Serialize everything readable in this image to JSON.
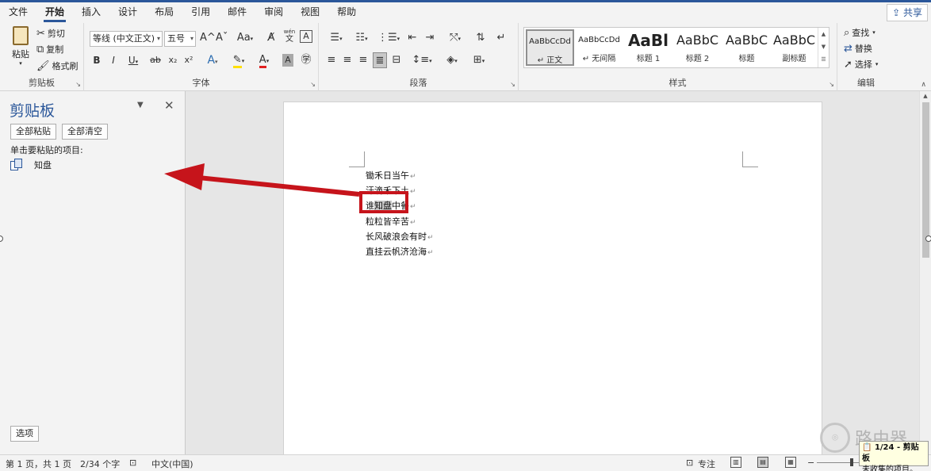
{
  "menu": {
    "tabs": [
      "文件",
      "开始",
      "插入",
      "设计",
      "布局",
      "引用",
      "邮件",
      "审阅",
      "视图",
      "帮助"
    ],
    "active": "开始",
    "share_label": "共享"
  },
  "ribbon": {
    "clipboard": {
      "paste": "粘贴",
      "cut": "剪切",
      "copy": "复制",
      "format_painter": "格式刷",
      "label": "剪贴板"
    },
    "font": {
      "font_name": "等线 (中文正文)",
      "font_size": "五号",
      "label": "字体",
      "bold": "B",
      "italic": "I",
      "underline": "U",
      "strike": "ab",
      "sub": "x₂",
      "sup": "x²",
      "grow": "A^",
      "shrink": "Aˇ",
      "case": "Aa",
      "wen": "wén",
      "wen_sub": "文"
    },
    "paragraph": {
      "label": "段落"
    },
    "styles": {
      "label": "样式",
      "items": [
        {
          "sample": "AaBbCcDd",
          "name": "↵ 正文"
        },
        {
          "sample": "AaBbCcDd",
          "name": "↵ 无间隔"
        },
        {
          "sample": "AaBl",
          "name": "标题 1"
        },
        {
          "sample": "AaBbC",
          "name": "标题 2"
        },
        {
          "sample": "AaBbC",
          "name": "标题"
        },
        {
          "sample": "AaBbC",
          "name": "副标题"
        }
      ]
    },
    "editing": {
      "label": "编辑",
      "find": "查找",
      "replace": "替换",
      "select": "选择"
    }
  },
  "clipboard_pane": {
    "title": "剪贴板",
    "paste_all": "全部粘贴",
    "clear_all": "全部清空",
    "hint": "单击要粘贴的项目:",
    "items": [
      "知盘"
    ],
    "options": "选项"
  },
  "document": {
    "lines": [
      "锄禾日当午",
      "汗滴禾下土",
      "谁知盘中餐",
      "粒粒皆辛苦",
      "长风破浪会有时",
      "直挂云帆济沧海"
    ],
    "highlight": "知盘",
    "paragraph_mark": "↵"
  },
  "status": {
    "page": "第 1 页，共 1 页",
    "words": "2/34 个字",
    "language": "中文(中国)",
    "focus": "专注"
  },
  "toast": {
    "line1": "1/24 - 剪贴板",
    "line2": "未收集的项目。"
  },
  "watermark": "路由器",
  "colors": {
    "accent": "#2b579a",
    "annotation_red": "#c6141b",
    "highlight_yellow": "#ffe000",
    "font_red": "#e02020"
  }
}
